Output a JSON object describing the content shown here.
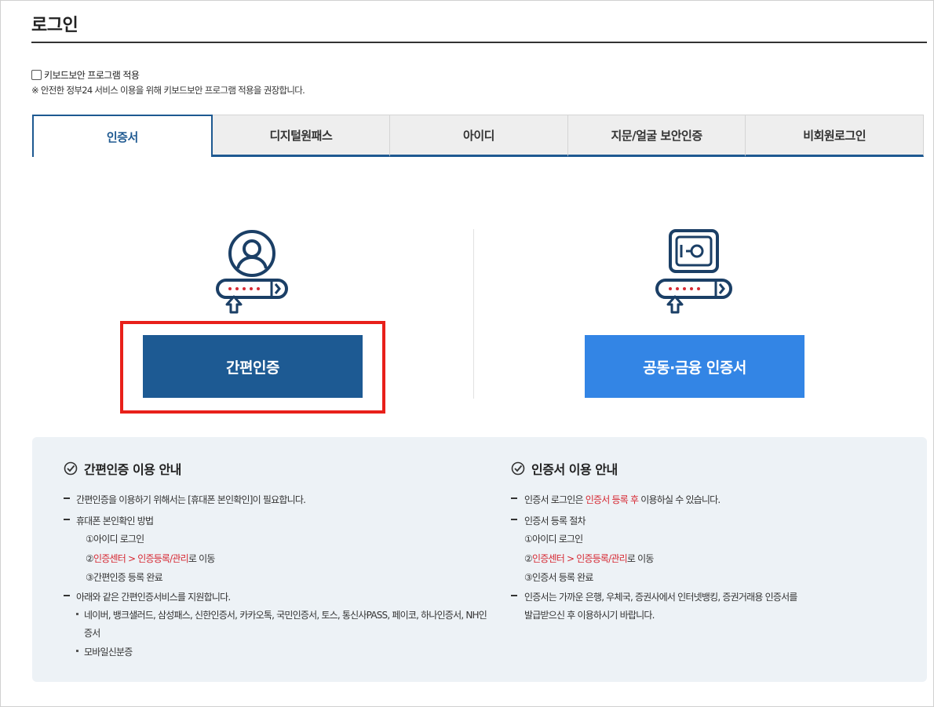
{
  "page": {
    "title": "로그인"
  },
  "keyboard_security": {
    "checkbox_label": "키보드보안 프로그램 적용",
    "checked": false,
    "note": "※ 안전한 정부24 서비스 이용을 위해 키보드보안 프로그램 적용을 권장합니다."
  },
  "tabs": [
    {
      "label": "인증서",
      "active": true
    },
    {
      "label": "디지털원패스",
      "active": false
    },
    {
      "label": "아이디",
      "active": false
    },
    {
      "label": "지문/얼굴 보안인증",
      "active": false
    },
    {
      "label": "비회원로그인",
      "active": false
    }
  ],
  "login_options": {
    "simple_auth_label": "간편인증",
    "joint_cert_label": "공동·금융 인증서"
  },
  "colors": {
    "primary": "#1d5a93",
    "secondary": "#3385e5",
    "highlight": "#e8201a",
    "info_bg": "#edf2f6",
    "emphasis_red": "#d62832"
  },
  "simple_auth_guide": {
    "heading": "간편인증 이용 안내",
    "line1": "간편인증을 이용하기 위해서는 [휴대폰 본인확인]이 필요합니다.",
    "line2": "휴대폰 본인확인 방법",
    "step1": "①아이디 로그인",
    "step2_prefix": "②",
    "step2_link": "인증센터 > 인증등록/관리",
    "step2_suffix": "로 이동",
    "step3": "③간편인증 등록 완료",
    "line3": "아래와 같은 간편인증서비스를 지원합니다.",
    "bullet1_line1": "네이버, 뱅크샐러드, 삼성패스, 신한인증서, 카카오톡, 국민인증서, 토스, 통신사PASS, 페이코, 하나인증서, NH인",
    "bullet1_line2": "증서",
    "bullet2": "모바일신분증"
  },
  "cert_guide": {
    "heading": "인증서 이용 안내",
    "line1_prefix": "인증서 로그인은 ",
    "line1_red": "인증서 등록 후",
    "line1_suffix": " 이용하실 수 있습니다.",
    "line2": "인증서 등록 절차",
    "step1": "①아이디 로그인",
    "step2_prefix": "②",
    "step2_link": "인증센터 > 인증등록/관리",
    "step2_suffix": "로 이동",
    "step3": "③인증서 등록 완료",
    "line3_a": "인증서는 가까운 은행, 우체국, 증권사에서 인터넷뱅킹, 증권거래용 인증서를",
    "line3_b": "발급받으신 후 이용하시기 바랍니다."
  }
}
